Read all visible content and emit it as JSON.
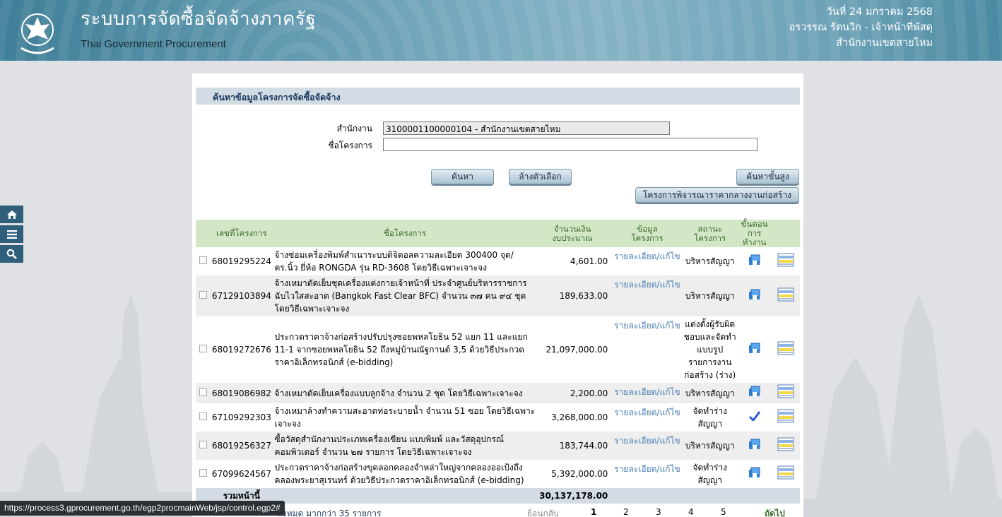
{
  "header": {
    "title": "ระบบการจัดซื้อจัดจ้างภาครัฐ",
    "subtitle": "Thai Government Procurement",
    "logo_text": "กรมบัญชีกลาง",
    "date": "วันที่ 24 มกราคม 2568",
    "user": "อรวรรณ รัตนวิก - เจ้าหน้าที่พัสดุ",
    "office": "สำนักงานเขตสายไหม"
  },
  "colors": {
    "header_bg": "#5f97ad",
    "section_bg": "#d3dbe4",
    "table_header_bg": "#d3e7c6",
    "link": "#4a7fb5",
    "nav_bg": "#2f5f7a"
  },
  "sidenav": [
    {
      "icon": "home-icon"
    },
    {
      "icon": "menu-icon"
    },
    {
      "icon": "search-icon"
    }
  ],
  "search": {
    "section_title": "ค้นหาข้อมูลโครงการจัดซื้อจัดจ้าง",
    "office_label": "สำนักงาน",
    "office_value": "3100001100000104 - สำนักงานเขตสายไหม",
    "project_label": "ชื่อโครงการ",
    "project_value": "",
    "search_btn": "ค้นหา",
    "clear_btn": "ล้างตัวเลือก",
    "advanced_btn": "ค้นหาขั้นสูง",
    "median_btn": "โครงการพิจารณาราคากลางงานก่อสร้าง"
  },
  "table": {
    "headers": {
      "no": "เลขที่โครงการ",
      "name": "ชื่อโครงการ",
      "amount_1": "จำนวนเงิน",
      "amount_2": "งบประมาณ",
      "info_1": "ข้อมูล",
      "info_2": "โครงการ",
      "status_1": "สถานะ",
      "status_2": "โครงการ",
      "step_1": "ขั้นตอน",
      "step_2": "การทำงาน"
    },
    "rows": [
      {
        "no": "68019295224",
        "name": "จ้างซ่อมเครื่องพิมพ์สำเนาระบบดิจิตอลความละเอียด 300400 จุด/ตร.นิ้ว ยี่ห้อ RONGDA รุ่น RD-3608 โดยวิธีเฉพาะเจาะจง",
        "amount": "4,601.00",
        "info": "รายละเอียด/แก้ไข",
        "status": "บริหารสัญญา",
        "step_icon": "contract-icon"
      },
      {
        "no": "67129103894",
        "name": "จ้างเหมาตัดเย็บชุดเครื่องแต่งกายเจ้าหน้าที่ ประจำศูนย์บริหารราชการฉับไวใสสะอาด (Bangkok Fast Clear BFC) จำนวน ๓๗ คน ๙๔ ชุด โดยวิธีเฉพาะเจาะจง",
        "amount": "189,633.00",
        "info": "รายละเอียด/แก้ไข",
        "status": "บริหารสัญญา",
        "step_icon": "contract-icon"
      },
      {
        "no": "68019272676",
        "name": "ประกวดราคาจ้างก่อสร้างปรับปรุงซอยพหลโยธิน 52 แยก 11 และแยก 11-1 จากซอยพหลโยธิน 52 ถึงหมู่บ้านณัฐกานต์ 3,5 ด้วยวิธีประกวดราคาอิเล็กทรอนิกส์ (e-bidding)",
        "amount": "21,097,000.00",
        "info": "รายละเอียด/แก้ไข",
        "status": "แต่งตั้งผู้รับผิดชอบและจัดทำแบบรูปรายการงานก่อสร้าง (ร่าง)",
        "step_icon": "contract-icon"
      },
      {
        "no": "68019086982",
        "name": "จ้างเหมาตัดเย็บเครื่องแบบลูกจ้าง จำนวน 2 ชุด โดยวิธีเฉพาะเจาะจง",
        "amount": "2,200.00",
        "info": "รายละเอียด/แก้ไข",
        "status": "บริหารสัญญา",
        "step_icon": "contract-icon"
      },
      {
        "no": "67109292303",
        "name": "จ้างเหมาล้างทำความสะอาดท่อระบายน้ำ จำนวน 51 ซอย โดยวิธีเฉพาะเจาะจง",
        "amount": "3,268,000.00",
        "info": "รายละเอียด/แก้ไข",
        "status": "จัดทำร่างสัญญา",
        "step_icon": "checkmark-icon"
      },
      {
        "no": "68019256327",
        "name": "ซื้อวัสดุสำนักงานประเภทเครื่องเขียน แบบพิมพ์ และวัสดุอุปกรณ์คอมพิวเตอร์ จำนวน ๒๗ รายการ โดยวิธีเฉพาะเจาะจง",
        "amount": "183,744.00",
        "info": "รายละเอียด/แก้ไข",
        "status": "บริหารสัญญา",
        "step_icon": "contract-icon"
      },
      {
        "no": "67099624567",
        "name": "ประกวดราคาจ้างก่อสร้างขุดลอกคลองจำหล่าใหญ่จากคลองออเป้งถึงคลองพระยาสุเรนทร์ ด้วยวิธีประกวดราคาอิเล็กทรอนิกส์ (e-bidding)",
        "amount": "5,392,000.00",
        "info": "รายละเอียด/แก้ไข",
        "status": "จัดทำร่างสัญญา",
        "step_icon": "contract-icon"
      }
    ],
    "total_label": "รวมหน้านี้",
    "total_amount": "30,137,178.00"
  },
  "pager": {
    "summary": "ทั้งหมด มากกว่า 35 รายการ",
    "prev": "ย้อนกลับ",
    "pages": [
      "1",
      "2",
      "3",
      "4",
      "5"
    ],
    "next": "ถัดไป"
  },
  "statusbar": {
    "url": "https://process3.gprocurement.go.th/egp2procmainWeb/jsp/control.egp2#"
  }
}
